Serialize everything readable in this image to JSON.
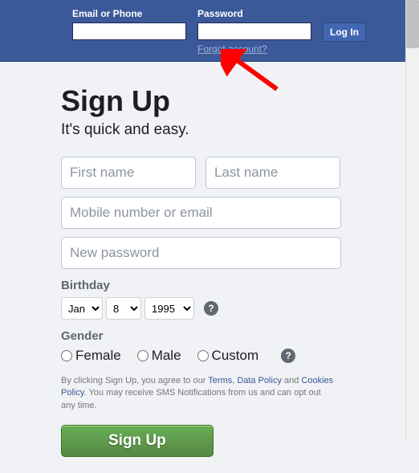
{
  "topbar": {
    "email_label": "Email or Phone",
    "password_label": "Password",
    "login_btn": "Log In",
    "forgot": "Forgot account?"
  },
  "signup": {
    "title": "Sign Up",
    "subtitle": "It's quick and easy.",
    "first_name_ph": "First name",
    "last_name_ph": "Last name",
    "contact_ph": "Mobile number or email",
    "password_ph": "New password",
    "birthday_label": "Birthday",
    "month": "Jan",
    "day": "8",
    "year": "1995",
    "gender_label": "Gender",
    "female": "Female",
    "male": "Male",
    "custom": "Custom",
    "terms_pre": "By clicking Sign Up, you agree to our ",
    "terms_link": "Terms",
    "terms_sep1": ", ",
    "data_link": "Data Policy",
    "terms_sep2": " and ",
    "cookies_link": "Cookies Policy",
    "terms_post": ". You may receive SMS Notifications from us and can opt out any time.",
    "signup_btn": "Sign Up",
    "help": "?"
  }
}
